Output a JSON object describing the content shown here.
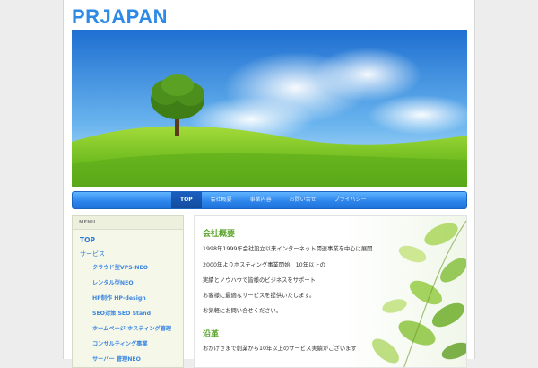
{
  "site": {
    "logo": "PRJAPAN"
  },
  "nav": [
    {
      "label": "TOP",
      "active": true
    },
    {
      "label": "会社概要",
      "active": false
    },
    {
      "label": "事業内容",
      "active": false
    },
    {
      "label": "お問い合せ",
      "active": false
    },
    {
      "label": "プライバシー",
      "active": false
    }
  ],
  "sidebar": {
    "heading": "MENU",
    "top": "TOP",
    "services": "サービス",
    "items": [
      "クラウド型VPS-NEO",
      "レンタル型NEO",
      "HP制作 HP-design",
      "SEO対策 SEO Stand",
      "ホームページ ホスティング管理",
      "コンサルティング事業",
      "サーバー 管理NEO"
    ]
  },
  "content": {
    "section1_title": "会社概要",
    "lines": [
      "1998年1999年会社設立以来インターネット関連事業を中心に展開",
      "2000年よりホスティング事業開始、10年以上の",
      "実績とノウハウで皆様のビジネスをサポート",
      "お客様に最適なサービスを提供いたします。",
      "お気軽にお問い合せください。"
    ],
    "section2_title": "沿革",
    "section2_line": "おかげさまで創業から10年以上のサービス実績がございます"
  },
  "colors": {
    "accent": "#2d8ae6",
    "nav": "#2b83ea",
    "green": "#5aa52a"
  }
}
